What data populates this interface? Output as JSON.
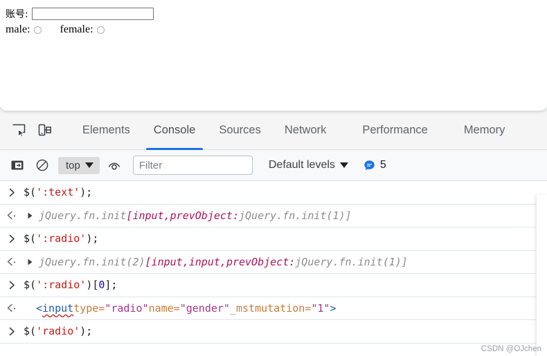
{
  "page": {
    "account_label": "账号:",
    "account_value": "",
    "account_placeholder": "",
    "male_label": "male:",
    "female_label": "female:"
  },
  "devtools": {
    "icons": {
      "inspect": "inspect-element-icon",
      "device": "device-toolbar-icon"
    },
    "tabs": [
      {
        "label": "Elements",
        "selected": false
      },
      {
        "label": "Console",
        "selected": true
      },
      {
        "label": "Sources",
        "selected": false
      },
      {
        "label": "Network",
        "selected": false
      },
      {
        "label": "Performance",
        "selected": false
      },
      {
        "label": "Memory",
        "selected": false
      }
    ],
    "toolbar": {
      "sidebar_toggle": "console-sidebar-icon",
      "clear_console": "clear-console-icon",
      "context": "top",
      "eye": "live-expression-icon",
      "filter_placeholder": "Filter",
      "filter_value": "",
      "levels": "Default levels",
      "message_count": "5"
    },
    "accent_color": "#1a73e8",
    "badge_color": "#1a73e8"
  },
  "console_log": [
    {
      "kind": "input",
      "marker": ">",
      "tokens": [
        {
          "t": "$(",
          "c": "c-punct"
        },
        {
          "t": "':text'",
          "c": "c-str"
        },
        {
          "t": ");",
          "c": "c-punct"
        }
      ]
    },
    {
      "kind": "output",
      "marker": "<",
      "expandable": true,
      "tokens": [
        {
          "t": "jQuery.fn.init ",
          "c": "c-obj"
        },
        {
          "t": "[input, ",
          "c": "c-prop"
        },
        {
          "t": "prevObject: ",
          "c": "c-prop"
        },
        {
          "t": "jQuery.fn.init(1)]",
          "c": "c-obj"
        }
      ]
    },
    {
      "kind": "input",
      "marker": ">",
      "tokens": [
        {
          "t": "$(",
          "c": "c-punct"
        },
        {
          "t": "':radio'",
          "c": "c-str"
        },
        {
          "t": ");",
          "c": "c-punct"
        }
      ]
    },
    {
      "kind": "output",
      "marker": "<",
      "expandable": true,
      "tokens": [
        {
          "t": "jQuery.fn.init(2) ",
          "c": "c-obj"
        },
        {
          "t": "[input, ",
          "c": "c-prop"
        },
        {
          "t": "input, ",
          "c": "c-prop"
        },
        {
          "t": "prevObject: ",
          "c": "c-prop"
        },
        {
          "t": "jQuery.fn.init(1)]",
          "c": "c-obj"
        }
      ]
    },
    {
      "kind": "input",
      "marker": ">",
      "tokens": [
        {
          "t": "$(",
          "c": "c-punct"
        },
        {
          "t": "':radio'",
          "c": "c-str"
        },
        {
          "t": ")[",
          "c": "c-punct"
        },
        {
          "t": "0",
          "c": "c-num"
        },
        {
          "t": "];",
          "c": "c-punct"
        }
      ]
    },
    {
      "kind": "output-html",
      "marker": "<",
      "expandable": false,
      "tokens": [
        {
          "t": "<",
          "c": "c-tag"
        },
        {
          "t": "input",
          "c": "c-tag squiggle"
        },
        {
          "t": " ",
          "c": "c-punct"
        },
        {
          "t": "type=",
          "c": "c-attr"
        },
        {
          "t": "\"radio\"",
          "c": "c-attrval"
        },
        {
          "t": " ",
          "c": "c-punct"
        },
        {
          "t": "name=",
          "c": "c-attr"
        },
        {
          "t": "\"gender\"",
          "c": "c-attrval"
        },
        {
          "t": " ",
          "c": "c-punct"
        },
        {
          "t": "_mstmutation=",
          "c": "c-attr"
        },
        {
          "t": "\"1\"",
          "c": "c-attrval"
        },
        {
          "t": ">",
          "c": "c-tag"
        }
      ]
    },
    {
      "kind": "input",
      "marker": ">",
      "tokens": [
        {
          "t": "$(",
          "c": "c-punct"
        },
        {
          "t": "'radio'",
          "c": "c-str"
        },
        {
          "t": ");",
          "c": "c-punct"
        }
      ]
    }
  ],
  "watermark": "CSDN @OJchen"
}
